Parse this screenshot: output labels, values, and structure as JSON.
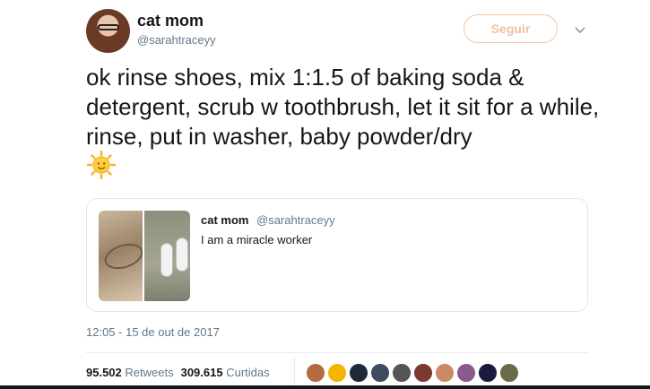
{
  "author": {
    "display_name": "cat mom",
    "handle": "@sarahtraceyy",
    "avatar_icon": "user-avatar"
  },
  "follow_button": {
    "label": "Seguir",
    "color": "#f1bfa0"
  },
  "menu_icon": "chevron-down-icon",
  "tweet": {
    "text": "ok rinse shoes, mix 1:1.5 of baking soda & detergent, scrub w toothbrush, let it sit for a while, rinse, put in washer, baby powder/dry",
    "emoji": "sun-with-face-icon"
  },
  "quoted_tweet": {
    "display_name": "cat mom",
    "handle": "@sarahtraceyy",
    "text": "I am a miracle worker",
    "images": [
      "shoe-sole-photo",
      "white-sneakers-photo"
    ]
  },
  "timestamp": "12:05 - 15 de out de 2017",
  "stats": {
    "retweets_count": "95.502",
    "retweets_label": "Retweets",
    "likes_count": "309.615",
    "likes_label": "Curtidas"
  },
  "likers": [
    {
      "name": "liker-avatar-1",
      "color": "#b56a3e"
    },
    {
      "name": "liker-avatar-2",
      "color": "#f5b400"
    },
    {
      "name": "liker-avatar-3",
      "color": "#1e2a38"
    },
    {
      "name": "liker-avatar-4",
      "color": "#3c4b5e"
    },
    {
      "name": "liker-avatar-5",
      "color": "#555555"
    },
    {
      "name": "liker-avatar-6",
      "color": "#7a3b2e"
    },
    {
      "name": "liker-avatar-7",
      "color": "#c98a64"
    },
    {
      "name": "liker-avatar-8",
      "color": "#8a5a8c"
    },
    {
      "name": "liker-avatar-9",
      "color": "#1a1a40"
    },
    {
      "name": "liker-avatar-10",
      "color": "#6b6b4a"
    }
  ]
}
